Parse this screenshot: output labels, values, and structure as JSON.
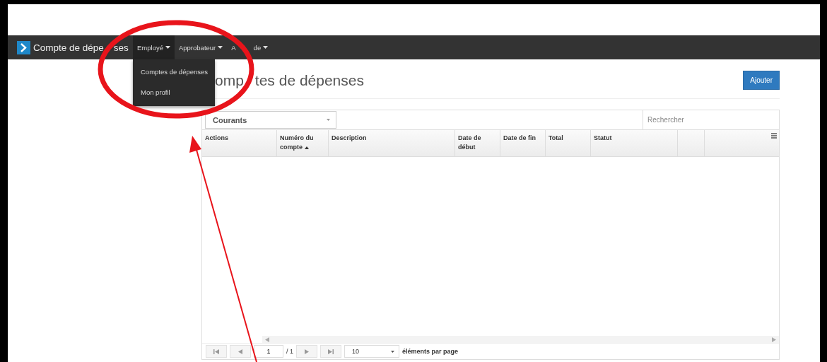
{
  "navbar": {
    "brand": [
      "Compte de dépe",
      "ses"
    ],
    "menus": [
      {
        "label": [
          "Employé"
        ],
        "expanded": true
      },
      {
        "label": [
          "Approbateur"
        ],
        "expanded": false
      },
      {
        "label": [
          "A",
          "de"
        ],
        "expanded": false
      }
    ],
    "dropdown": [
      "Comptes de dépenses",
      "Mon profil"
    ]
  },
  "page": {
    "title": [
      "omp",
      "tes de dépenses"
    ],
    "add_button": "Ajouter"
  },
  "grid": {
    "filter": "Courants",
    "search": {
      "placeholder": "Rechercher"
    },
    "columns": [
      {
        "label": "Actions",
        "sorted": false
      },
      {
        "label": "Numéro du compte",
        "sorted": true
      },
      {
        "label": "Description",
        "sorted": false
      },
      {
        "label": "Date de début",
        "sorted": false
      },
      {
        "label": "Date de fin",
        "sorted": false
      },
      {
        "label": "Total",
        "sorted": false
      },
      {
        "label": "Statut",
        "sorted": false
      }
    ],
    "pager": {
      "page": "1",
      "of": "/ 1",
      "page_size": "10",
      "page_size_label": "éléments par page"
    }
  }
}
